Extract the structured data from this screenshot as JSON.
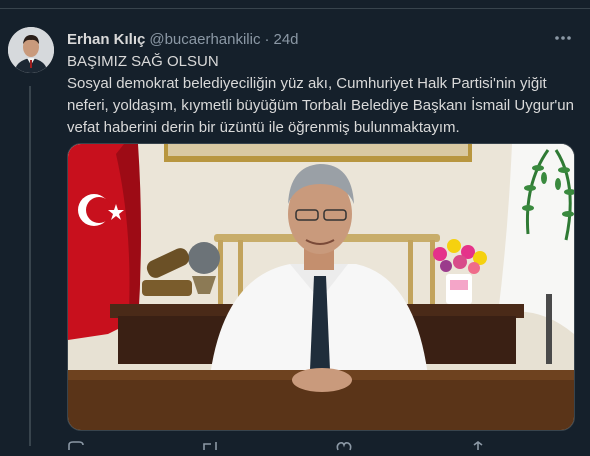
{
  "tweet": {
    "author_name": "Erhan Kılıç",
    "handle": "@bucaerhankilic",
    "separator": "·",
    "time": "24d",
    "text_line1": "BAŞIMIZ SAĞ OLSUN",
    "text_body": "Sosyal demokrat belediyeciliğin yüz akı, Cumhuriyet Halk Partisi'nin yiğit neferi, yoldaşım, kıymetli büyüğüm Torbalı Belediye Başkanı İsmail Uygur'un vefat haberini derin bir üzüntü ile öğrenmiş bulunmaktayım."
  },
  "icons": {
    "more": "more-horizontal-icon",
    "reply": "reply-icon",
    "retweet": "retweet-icon",
    "like": "like-icon",
    "share": "share-icon"
  },
  "colors": {
    "background": "#15202b",
    "text": "#d9d9d9",
    "secondary": "#8b98a5",
    "border": "#38444d"
  }
}
